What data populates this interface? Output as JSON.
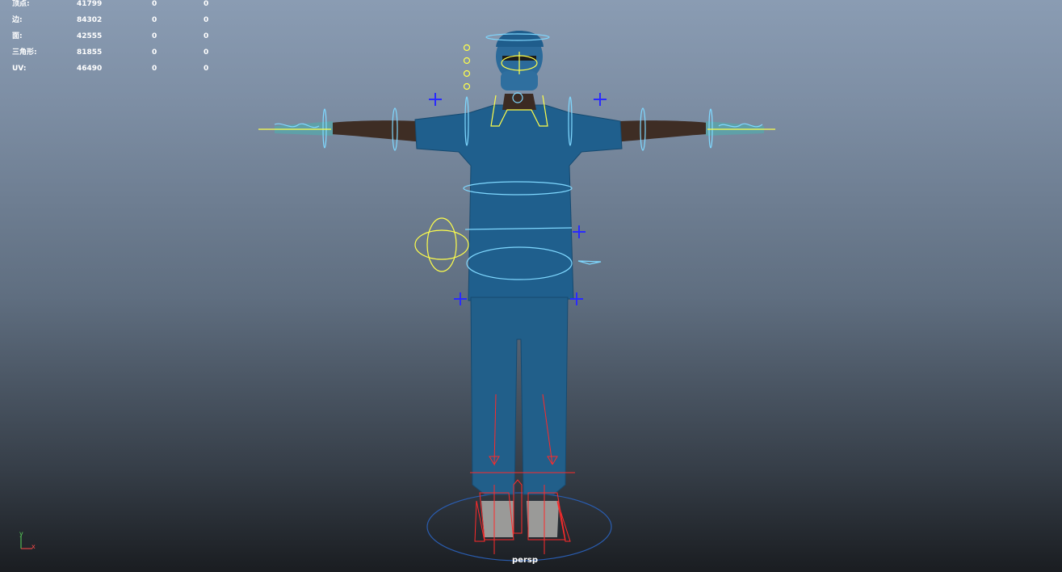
{
  "hud": {
    "rows": [
      {
        "label": "顶点:",
        "v1": "41799",
        "v2": "0",
        "v3": "0"
      },
      {
        "label": "边:",
        "v1": "84302",
        "v2": "0",
        "v3": "0"
      },
      {
        "label": "面:",
        "v1": "42555",
        "v2": "0",
        "v3": "0"
      },
      {
        "label": "三角形:",
        "v1": "81855",
        "v2": "0",
        "v3": "0"
      },
      {
        "label": "UV:",
        "v1": "46490",
        "v2": "0",
        "v3": "0"
      }
    ]
  },
  "viewport": {
    "camera": "persp",
    "axis_y": "y",
    "axis_x": "x"
  },
  "colors": {
    "background_top": "#8a9cb3",
    "background_bottom": "#1a1d21",
    "scrubs": "#1f5f8d",
    "control_cyan": "#7fd8ff",
    "control_yellow": "#ffff4a",
    "control_blue": "#2a2aff",
    "control_red": "#ff2a2a"
  }
}
